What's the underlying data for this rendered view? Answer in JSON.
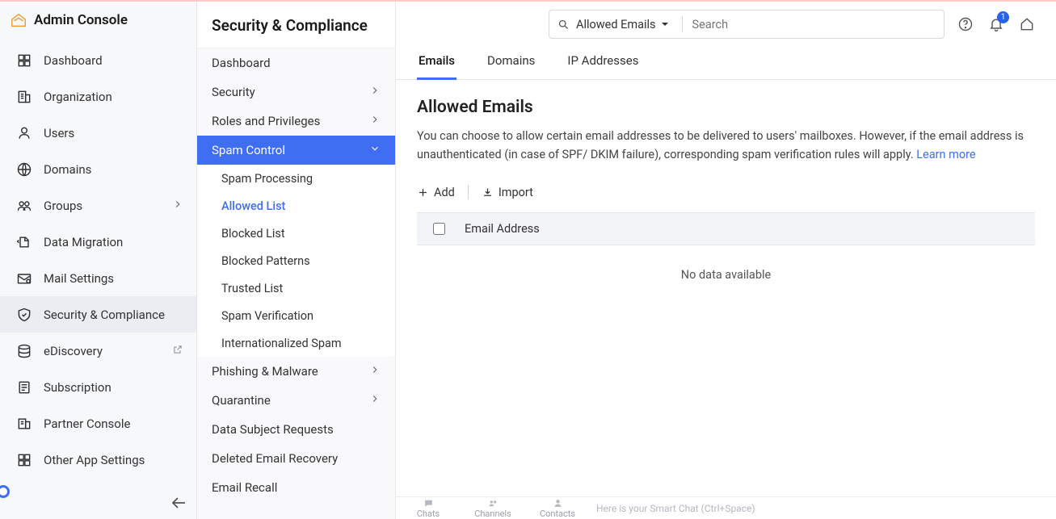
{
  "brand": {
    "title": "Admin Console"
  },
  "sidebar1": {
    "items": [
      {
        "label": "Dashboard"
      },
      {
        "label": "Organization"
      },
      {
        "label": "Users"
      },
      {
        "label": "Domains"
      },
      {
        "label": "Groups",
        "hasChevron": true
      },
      {
        "label": "Data Migration"
      },
      {
        "label": "Mail Settings"
      },
      {
        "label": "Security & Compliance",
        "active": true
      },
      {
        "label": "eDiscovery",
        "external": true
      },
      {
        "label": "Subscription"
      },
      {
        "label": "Partner Console"
      },
      {
        "label": "Other App Settings"
      }
    ]
  },
  "sidebar2": {
    "title": "Security & Compliance",
    "items": [
      {
        "label": "Dashboard"
      },
      {
        "label": "Security",
        "hasChevron": true
      },
      {
        "label": "Roles and Privileges",
        "hasChevron": true
      },
      {
        "label": "Spam Control",
        "hasChevron": true,
        "expanded": true,
        "subitems": [
          {
            "label": "Spam Processing"
          },
          {
            "label": "Allowed List",
            "active": true
          },
          {
            "label": "Blocked List"
          },
          {
            "label": "Blocked Patterns"
          },
          {
            "label": "Trusted List"
          },
          {
            "label": "Spam Verification"
          },
          {
            "label": "Internationalized Spam"
          }
        ]
      },
      {
        "label": "Phishing & Malware",
        "hasChevron": true
      },
      {
        "label": "Quarantine",
        "hasChevron": true
      },
      {
        "label": "Data Subject Requests"
      },
      {
        "label": "Deleted Email Recovery"
      },
      {
        "label": "Email Recall"
      }
    ]
  },
  "search": {
    "filter_label": "Allowed Emails",
    "placeholder": "Search"
  },
  "notifications": {
    "count": "1"
  },
  "tabs": [
    {
      "label": "Emails",
      "active": true
    },
    {
      "label": "Domains"
    },
    {
      "label": "IP Addresses"
    }
  ],
  "page": {
    "title": "Allowed Emails",
    "description": "You can choose to allow certain email addresses to be delivered to users' mailboxes. However, if the email address is unauthenticated (in case of SPF/ DKIM failure), corresponding spam verification rules will apply. ",
    "learn_more": "Learn more"
  },
  "actions": {
    "add": "Add",
    "import": "Import"
  },
  "table": {
    "column": "Email Address",
    "empty": "No data available"
  },
  "chatbar": {
    "items": [
      {
        "label": "Chats"
      },
      {
        "label": "Channels"
      },
      {
        "label": "Contacts"
      }
    ],
    "placeholder": "Here is your Smart Chat (Ctrl+Space)"
  }
}
